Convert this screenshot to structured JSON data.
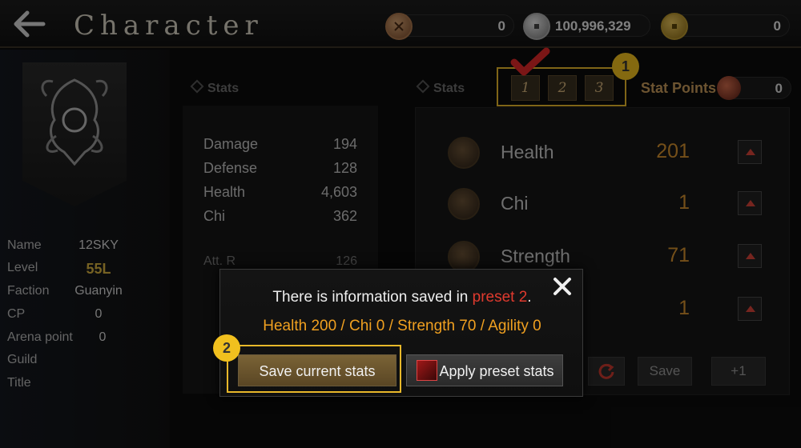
{
  "header": {
    "title": "Character",
    "back_icon": "back-arrow-icon",
    "currencies": [
      {
        "icon": "bronze-coin-icon",
        "value": "0"
      },
      {
        "icon": "silver-coin-icon",
        "value": "100,996,329"
      },
      {
        "icon": "gold-coin-icon",
        "value": "0"
      }
    ]
  },
  "profile": {
    "banner_icon": "dragon-emblem-icon",
    "fields": [
      {
        "key": "Name",
        "value": "12SKY"
      },
      {
        "key": "Level",
        "value": "55L"
      },
      {
        "key": "Faction",
        "value": "Guanyin"
      },
      {
        "key": "CP",
        "value": "0"
      },
      {
        "key": "Arena point",
        "value": "0"
      },
      {
        "key": "Guild",
        "value": ""
      },
      {
        "key": "Title",
        "value": ""
      }
    ]
  },
  "stats_panel": {
    "header": "Stats",
    "rows": [
      {
        "label": "Damage",
        "value": "194"
      },
      {
        "label": "Defense",
        "value": "128"
      },
      {
        "label": "Health",
        "value": "4,603"
      },
      {
        "label": "Chi",
        "value": "362"
      }
    ],
    "secondary_rows": [
      {
        "label": "Att. R",
        "value": "126"
      }
    ]
  },
  "allocation": {
    "header": "Stats",
    "presets": [
      "1",
      "2",
      "3"
    ],
    "stat_points_label": "Stat Points",
    "stat_points_value": "0",
    "rows": [
      {
        "label": "Health",
        "value": "201",
        "icon": "health-body-icon"
      },
      {
        "label": "Chi",
        "value": "1",
        "icon": "chi-body-icon"
      },
      {
        "label": "Strength",
        "value": "71",
        "icon": "strength-fist-icon"
      },
      {
        "label": "",
        "value": "1",
        "icon": "agility-icon"
      }
    ],
    "save_label": "Save",
    "plus_label": "+1"
  },
  "callouts": [
    "1",
    "2"
  ],
  "modal": {
    "message_prefix": "There is information saved in ",
    "message_highlight": "preset 2",
    "message_suffix": ".",
    "preset_stats": "Health 200 / Chi 0 / Strength 70 / Agility 0",
    "save_current_label": "Save current stats",
    "apply_preset_label": "Apply preset stats"
  },
  "colors": {
    "accent_gold": "#e8b82a",
    "value_orange": "#d3902e",
    "highlight_red": "#e03a2e",
    "check_red": "#e02828"
  }
}
